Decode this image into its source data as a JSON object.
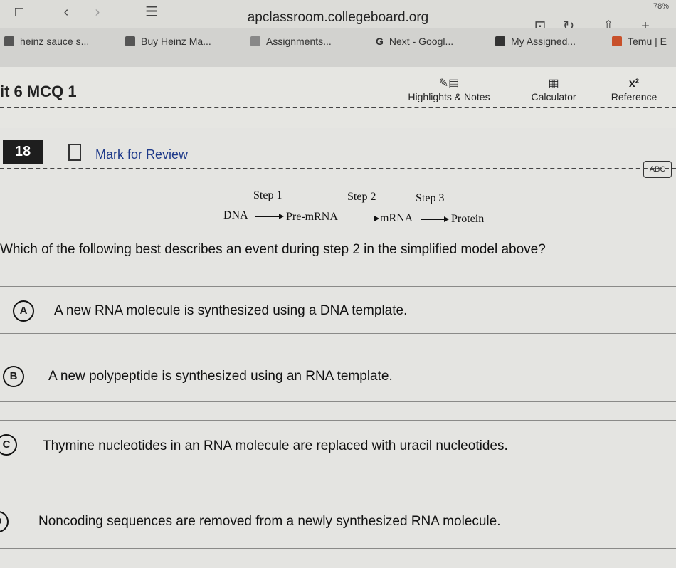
{
  "browser": {
    "url": "apclassroom.collegeboard.org",
    "battery": "78%"
  },
  "bookmarks": [
    {
      "label": "heinz sauce s..."
    },
    {
      "label": "Buy Heinz Ma..."
    },
    {
      "label": "Assignments..."
    },
    {
      "label": "Next - Googl..."
    },
    {
      "label": "My Assigned..."
    },
    {
      "label": "Temu | E"
    }
  ],
  "header": {
    "section_title": "it 6 MCQ 1",
    "tools": {
      "highlights": "Highlights & Notes",
      "calculator": "Calculator",
      "reference": "Reference"
    }
  },
  "question": {
    "number": "18",
    "mark_for_review": "Mark for Review",
    "abc_label": "ABC",
    "diagram": {
      "step_labels": [
        "Step 1",
        "Step 2",
        "Step 3"
      ],
      "nodes": [
        "DNA",
        "Pre-mRNA",
        "mRNA",
        "Protein"
      ]
    },
    "text": "Which of the following best describes an event during step 2 in the simplified model above?",
    "options": [
      {
        "letter": "A",
        "text": "A new RNA molecule is synthesized using a DNA template."
      },
      {
        "letter": "B",
        "text": "A new polypeptide is synthesized using an RNA template."
      },
      {
        "letter": "C",
        "text": "Thymine nucleotides in an RNA molecule are replaced with uracil nucleotides."
      },
      {
        "letter": "D",
        "text": "Noncoding sequences are removed from a newly synthesized RNA molecule."
      }
    ]
  }
}
